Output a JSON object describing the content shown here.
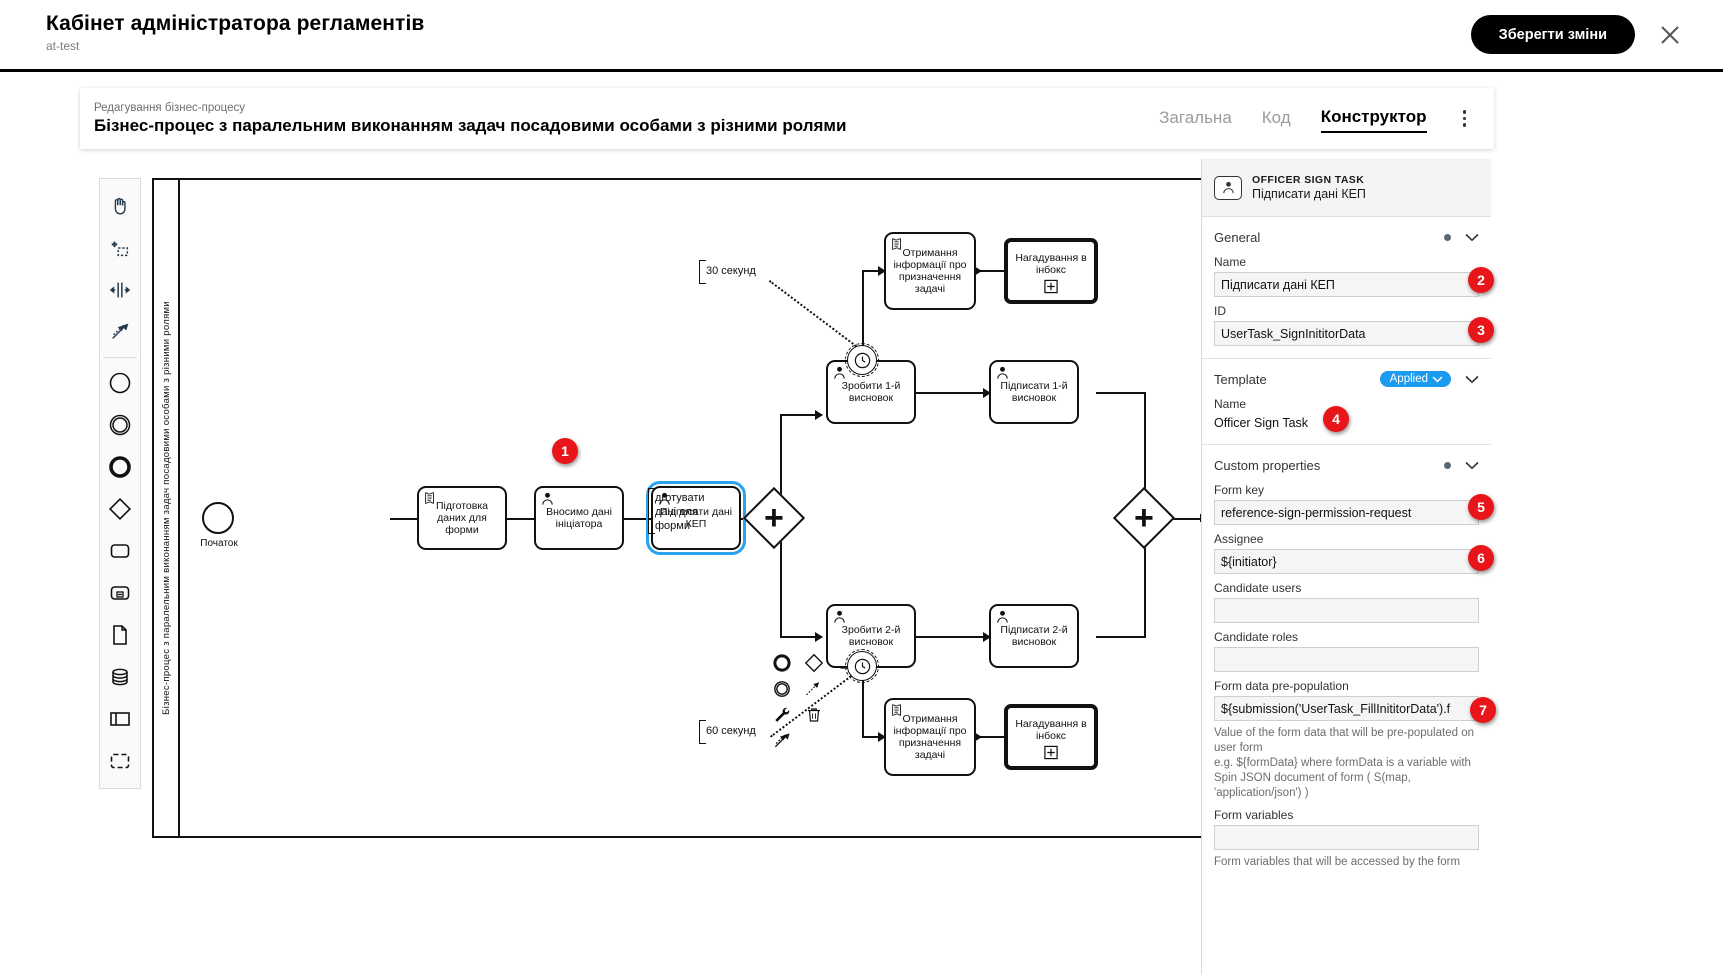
{
  "appbar": {
    "title": "Кабінет адміністратора регламентів",
    "subtitle": "at-test",
    "save_label": "Зберегти зміни",
    "close_icon": "close-icon"
  },
  "process_card": {
    "eyebrow": "Редагування бізнес-процесу",
    "name": "Бізнес-процес з паралельним виконанням задач посадовими особами з різними ролями",
    "tabs": [
      {
        "label": "Загальна",
        "active": false
      },
      {
        "label": "Код",
        "active": false
      },
      {
        "label": "Конструктор",
        "active": true
      }
    ],
    "kebab_icon": "more-vertical-icon"
  },
  "palette": {
    "items": [
      {
        "name": "hand-tool-icon",
        "label": "Activate the hand tool"
      },
      {
        "name": "lasso-tool-icon",
        "label": "Activate the lasso tool"
      },
      {
        "name": "space-tool-icon",
        "label": "Activate the create/remove space tool"
      },
      {
        "name": "global-connect-tool-icon",
        "label": "Activate the global connect tool"
      },
      {
        "name": "start-event-icon",
        "label": "Create StartEvent"
      },
      {
        "name": "intermediate-event-icon",
        "label": "Create Intermediate/Boundary Event"
      },
      {
        "name": "end-event-icon",
        "label": "Create EndEvent"
      },
      {
        "name": "gateway-icon",
        "label": "Create Gateway"
      },
      {
        "name": "task-icon",
        "label": "Create Task"
      },
      {
        "name": "subprocess-collapsed-icon",
        "label": "Create collapsed Sub-Process"
      },
      {
        "name": "data-object-icon",
        "label": "Create DataObjectReference"
      },
      {
        "name": "data-store-icon",
        "label": "Create DataStoreReference"
      },
      {
        "name": "participant-icon",
        "label": "Create Pool/Participant"
      },
      {
        "name": "group-icon",
        "label": "Create Group"
      }
    ]
  },
  "diagram": {
    "lane_label": "Бізнес-процес з паралельним виконанням задач посадовими особами з різними ролями",
    "start_event_label": "Початок",
    "nodes": [
      {
        "id": "n1",
        "label": "Підготовка даних для форми",
        "icon": "script-task-icon"
      },
      {
        "id": "n2",
        "label": "Вносимо дані ініціатора",
        "icon": "user-task-icon"
      },
      {
        "id": "n3",
        "label": "Підписати дані КЕП",
        "icon": "user-task-icon",
        "selected": true
      },
      {
        "id": "n4",
        "label": "Отримання інформації про призначення задачі",
        "icon": "script-task-icon"
      },
      {
        "id": "n5",
        "label": "Нагадування в інбокс",
        "icon": "call-activity-icon",
        "marker": "collapsed-plus-icon"
      },
      {
        "id": "n6",
        "label": "Зробити 1-й висновок",
        "icon": "user-task-icon"
      },
      {
        "id": "n7",
        "label": "Підписати 1-й висновок",
        "icon": "user-task-icon"
      },
      {
        "id": "n8",
        "label": "Зробити 2-й висновок",
        "icon": "user-task-icon"
      },
      {
        "id": "n9",
        "label": "Підписати 2-й висновок",
        "icon": "user-task-icon"
      },
      {
        "id": "n10",
        "label": "Отримання інформації про призначення задачі",
        "icon": "script-task-icon"
      },
      {
        "id": "n11",
        "label": "Нагадування в інбокс",
        "icon": "call-activity-icon",
        "marker": "collapsed-plus-icon"
      }
    ],
    "annotations": [
      {
        "id": "a1",
        "text": "30 секунд"
      },
      {
        "id": "a2",
        "text": "60 секунд"
      }
    ],
    "context_pad_annotation": "дготувати дані для форми",
    "context_pad_items": [
      {
        "name": "append-end-event-icon"
      },
      {
        "name": "append-gateway-icon"
      },
      {
        "name": "append-task-icon"
      },
      {
        "name": "append-intermediate-event-icon"
      },
      {
        "name": "append-text-annotation-icon"
      },
      {
        "name": "wrench-icon"
      },
      {
        "name": "trash-icon"
      },
      {
        "name": "connect-icon"
      }
    ]
  },
  "properties": {
    "header": {
      "type": "OFFICER SIGN TASK",
      "name": "Підписати дані КЕП",
      "icon": "user-task-icon"
    },
    "groups": [
      {
        "title": "General",
        "has_dot": true,
        "fields": [
          {
            "label": "Name",
            "value": "Підписати дані КЕП",
            "kind": "input"
          },
          {
            "label": "ID",
            "value": "UserTask_SignInititorData",
            "kind": "input"
          }
        ]
      },
      {
        "title": "Template",
        "badge": "Applied",
        "fields": [
          {
            "label": "Name",
            "value": "Officer Sign Task",
            "kind": "static"
          }
        ]
      },
      {
        "title": "Custom properties",
        "has_dot": true,
        "fields": [
          {
            "label": "Form key",
            "value": "reference-sign-permission-request",
            "kind": "input"
          },
          {
            "label": "Assignee",
            "value": "${initiator}",
            "kind": "input"
          },
          {
            "label": "Candidate users",
            "value": "",
            "kind": "input"
          },
          {
            "label": "Candidate roles",
            "value": "",
            "kind": "input"
          },
          {
            "label": "Form data pre-population",
            "value": "${submission('UserTask_FillInititorData').f",
            "kind": "input",
            "help": "Value of the form data that will be pre-populated on user form\ne.g. ${formData} where formData is a variable with Spin JSON document of form ( S(map, 'application/json') )"
          },
          {
            "label": "Form variables",
            "value": "",
            "kind": "input",
            "help": "Form variables that will be accessed by the form"
          }
        ]
      }
    ]
  },
  "markers": [
    {
      "n": "1"
    },
    {
      "n": "2"
    },
    {
      "n": "3"
    },
    {
      "n": "4"
    },
    {
      "n": "5"
    },
    {
      "n": "6"
    },
    {
      "n": "7"
    }
  ],
  "colors": {
    "accent_black": "#000000",
    "marker_red": "#e8161a",
    "selection_blue": "#2aa3ef",
    "badge_blue": "#1a9bf0",
    "panel_bg": "#f4f4f4",
    "field_bg": "#f5f5f5"
  }
}
